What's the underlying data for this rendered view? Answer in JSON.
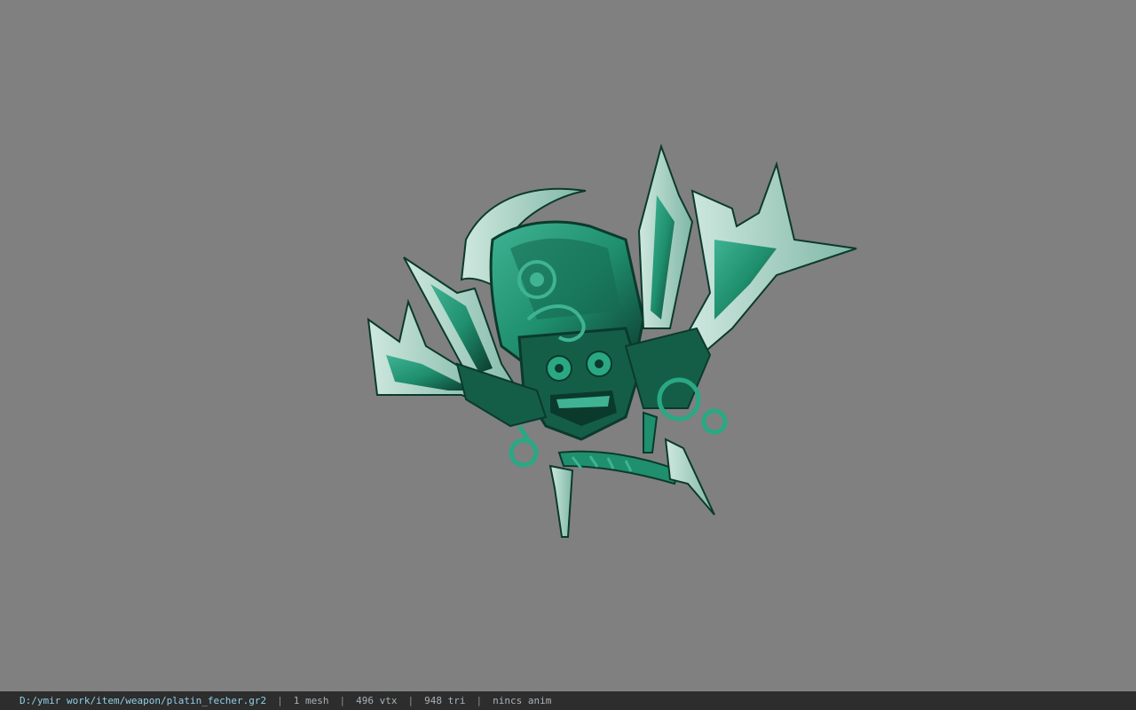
{
  "viewer": {
    "background_color": "#808080",
    "model_primary_color": "#1f8f6e",
    "model_highlight_color": "#9fd8c6",
    "model_shadow_color": "#0b3a2c"
  },
  "statusbar": {
    "file_path": "D:/ymir work/item/weapon/platin_fecher.gr2",
    "separator": "|",
    "mesh_count": "1 mesh",
    "vertex_count": "496 vtx",
    "triangle_count": "948 tri",
    "animation": "nincs anim"
  }
}
